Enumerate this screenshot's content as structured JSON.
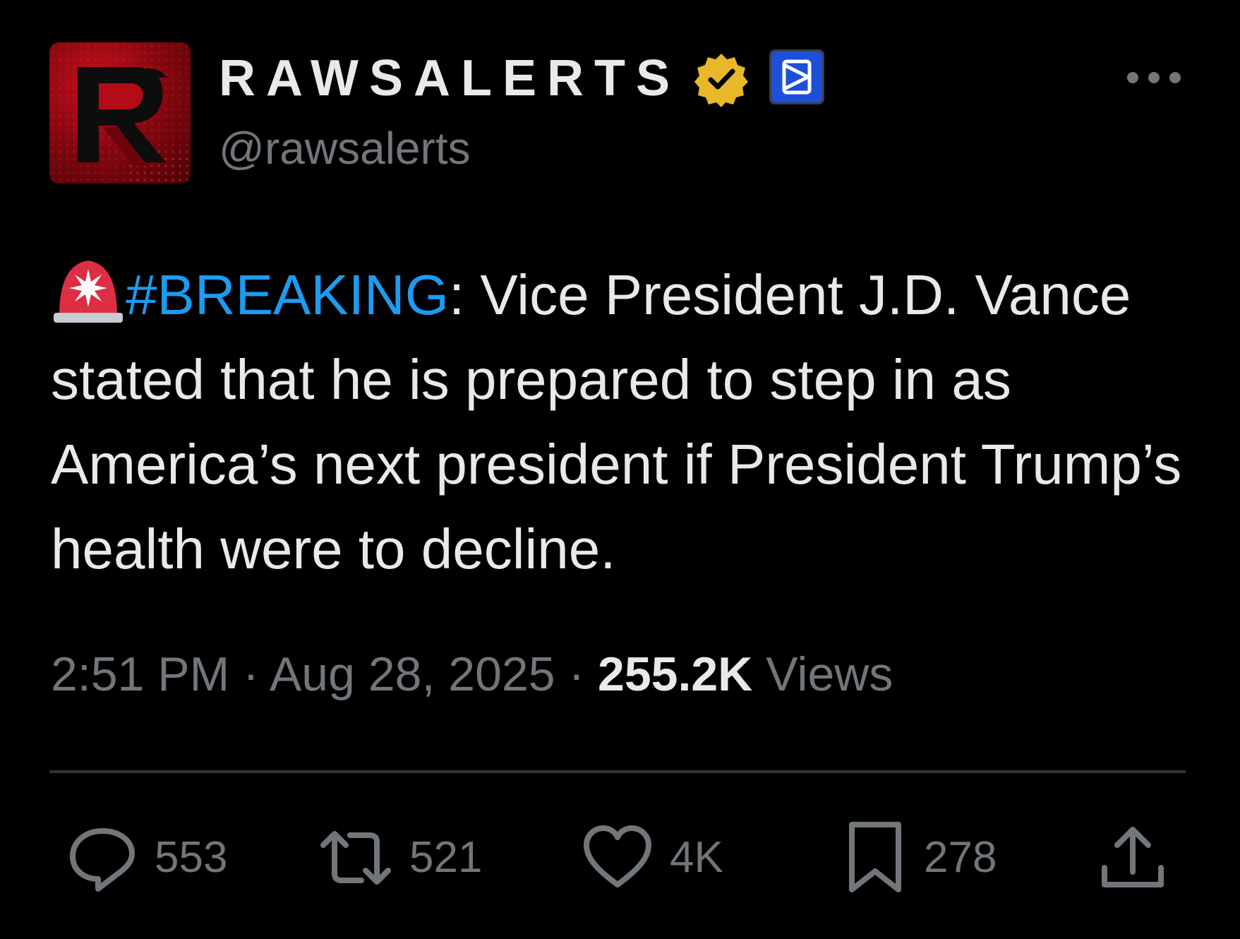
{
  "author": {
    "display_name": "RAWSALERTS",
    "handle": "@rawsalerts"
  },
  "tweet": {
    "hashtag": "#BREAKING",
    "text": ": Vice President J.D. Vance stated that he is prepared to step in as America’s next president if President Trump’s health were to decline."
  },
  "meta": {
    "time": "2:51 PM",
    "separator": "·",
    "date": "Aug 28, 2025",
    "views_count": "255.2K",
    "views_label": "Views"
  },
  "actions": {
    "replies": "553",
    "reposts": "521",
    "likes": "4K",
    "bookmarks": "278"
  },
  "icons": {
    "reply": "reply-icon",
    "repost": "repost-icon",
    "like": "heart-icon",
    "bookmark": "bookmark-icon",
    "share": "share-icon",
    "more": "more-icon",
    "verified": "verified-badge-icon",
    "affiliate": "affiliate-badge-icon",
    "siren": "siren-emoji-icon"
  },
  "colors": {
    "background": "#000000",
    "text": "#e7e9ea",
    "muted": "#71767b",
    "link": "#1d9bf0",
    "verified_gold": "#e8b82a",
    "affiliate_blue": "#1d4fd8"
  }
}
